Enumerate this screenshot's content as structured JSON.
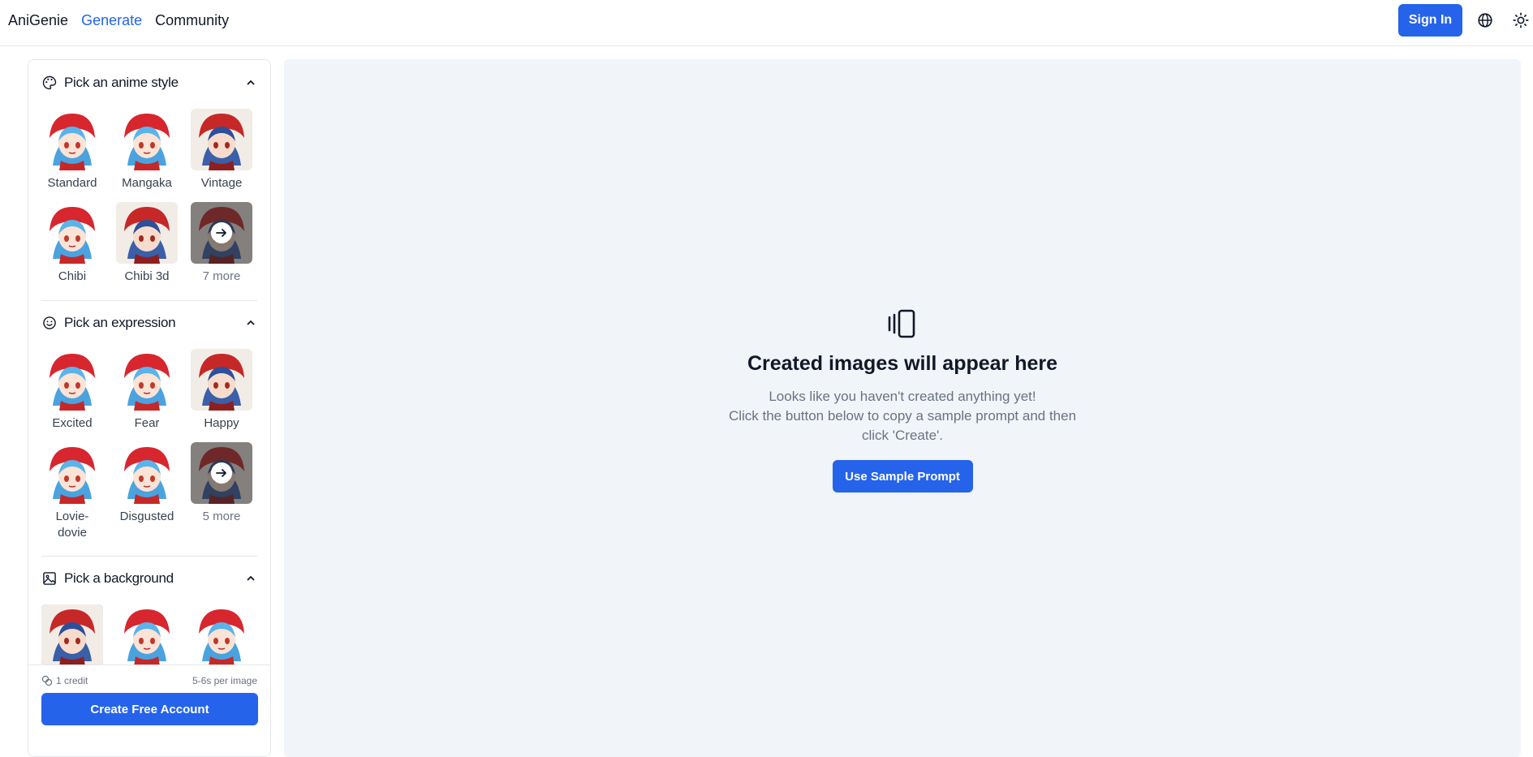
{
  "header": {
    "brand": "AniGenie",
    "nav": [
      "Generate",
      "Community"
    ],
    "sign_in": "Sign In",
    "icons": [
      "globe-icon",
      "sun-icon"
    ]
  },
  "sidebar": {
    "styles": {
      "title": "Pick an anime style",
      "items": [
        "Standard",
        "Mangaka",
        "Vintage",
        "Chibi",
        "Chibi 3d"
      ],
      "more": "7 more"
    },
    "expressions": {
      "title": "Pick an expression",
      "items": [
        "Excited",
        "Fear",
        "Happy",
        "Lovie-dovie",
        "Disgusted"
      ],
      "more": "5 more"
    },
    "backgrounds": {
      "title": "Pick a background"
    },
    "footer": {
      "credit": "1 credit",
      "speed": "5-6s per image",
      "create_account": "Create Free Account"
    }
  },
  "main": {
    "empty_title": "Created images will appear here",
    "empty_line1": "Looks like you haven't created anything yet!",
    "empty_line2": "Click the button below to copy a sample prompt and then click 'Create'.",
    "sample_button": "Use Sample Prompt"
  },
  "colors": {
    "accent": "#2563eb",
    "main_bg": "#f1f4f9"
  }
}
